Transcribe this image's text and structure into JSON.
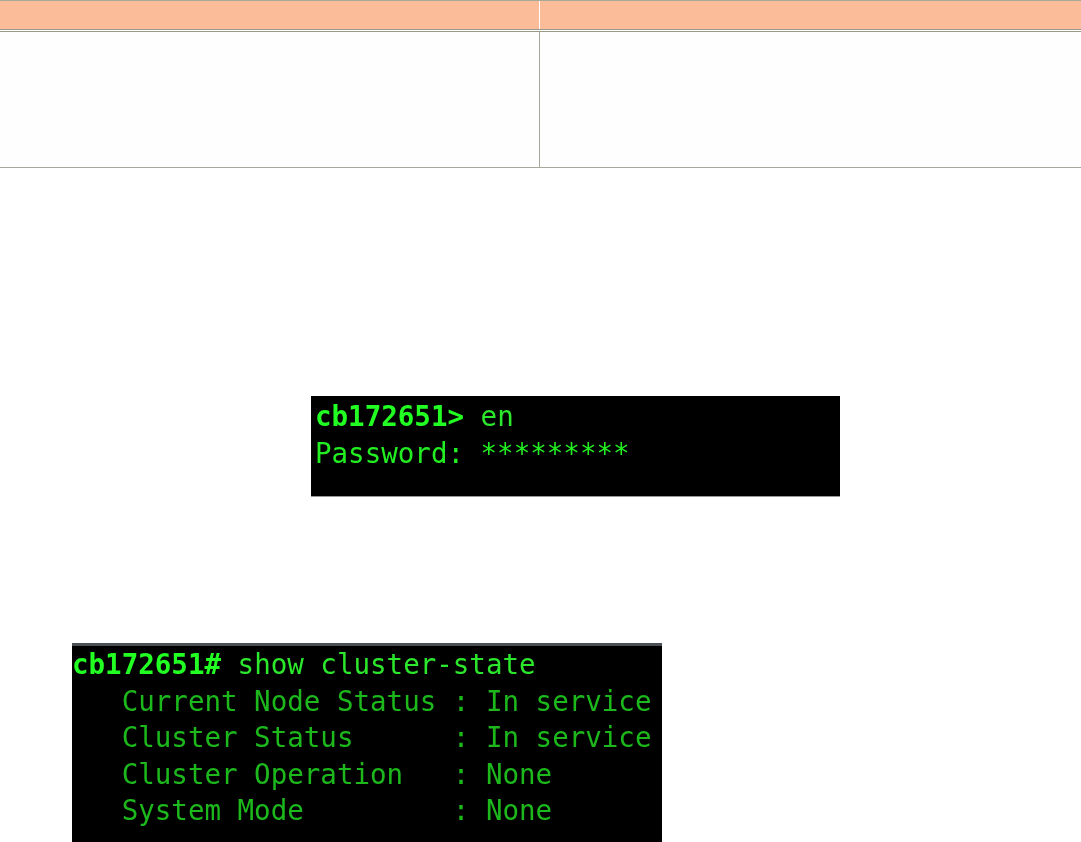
{
  "table": {
    "columns": [
      {
        "kind": "blank"
      },
      {
        "kind": "blank"
      }
    ],
    "rows": [
      {
        "cells": [
          {
            "kind": "blank"
          },
          {
            "kind": "blank"
          }
        ]
      }
    ]
  },
  "terminals": [
    {
      "lines": [
        {
          "kind": "prompt",
          "text": "**cb172651>** en"
        },
        {
          "kind": "input",
          "text": "Password: *********"
        }
      ]
    },
    {
      "lines": [
        {
          "kind": "prompt",
          "text": "**cb172651#** show cluster-state"
        },
        {
          "kind": "output",
          "text": "   Current Node Status : In service"
        },
        {
          "kind": "output",
          "text": "   Cluster Status      : In service"
        },
        {
          "kind": "output",
          "text": "   Cluster Operation   : None"
        },
        {
          "kind": "output",
          "text": "   System Mode         : None"
        }
      ]
    }
  ]
}
